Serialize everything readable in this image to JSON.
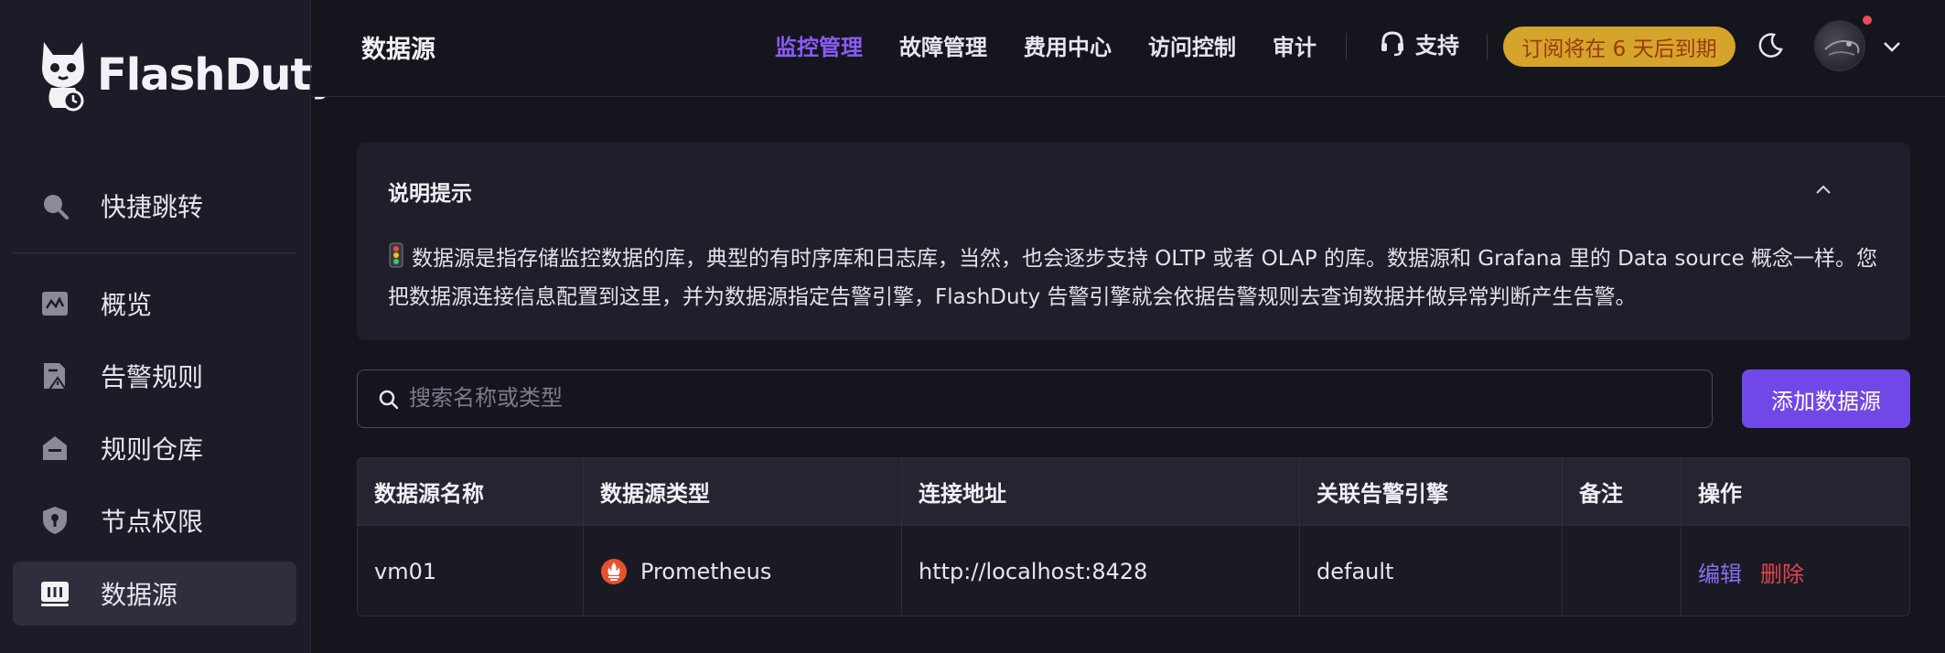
{
  "app": {
    "brand": "FlashDuty"
  },
  "sidebar": {
    "items": [
      {
        "label": "快捷跳转",
        "icon": "search-icon"
      },
      {
        "label": "概览",
        "icon": "dashboard-icon"
      },
      {
        "label": "告警规则",
        "icon": "alert-rule-icon"
      },
      {
        "label": "规则仓库",
        "icon": "warehouse-icon"
      },
      {
        "label": "节点权限",
        "icon": "shield-key-icon"
      },
      {
        "label": "数据源",
        "icon": "datasource-icon",
        "active": true
      }
    ]
  },
  "header": {
    "title": "数据源",
    "nav": [
      "监控管理",
      "故障管理",
      "费用中心",
      "访问控制",
      "审计"
    ],
    "active_nav": "监控管理",
    "support_label": "支持",
    "subscription_badge": "订阅将在 6 天后到期",
    "badge_color": "#d4a52a",
    "accent_color": "#8b5cf6"
  },
  "notice": {
    "title": "说明提示",
    "body": "数据源是指存储监控数据的库，典型的有时序库和日志库，当然，也会逐步支持 OLTP 或者 OLAP 的库。数据源和 Grafana 里的 Data source 概念一样。您把数据源连接信息配置到这里，并为数据源指定告警引擎，FlashDuty 告警引擎就会依据告警规则去查询数据并做异常判断产生告警。"
  },
  "search": {
    "placeholder": "搜索名称或类型",
    "value": ""
  },
  "add_button": "添加数据源",
  "table": {
    "columns": [
      "数据源名称",
      "数据源类型",
      "连接地址",
      "关联告警引擎",
      "备注",
      "操作"
    ],
    "rows": [
      {
        "name": "vm01",
        "type": "Prometheus",
        "url": "http://localhost:8428",
        "engine": "default",
        "note": "",
        "actions": {
          "edit": "编辑",
          "delete": "删除"
        }
      }
    ]
  }
}
